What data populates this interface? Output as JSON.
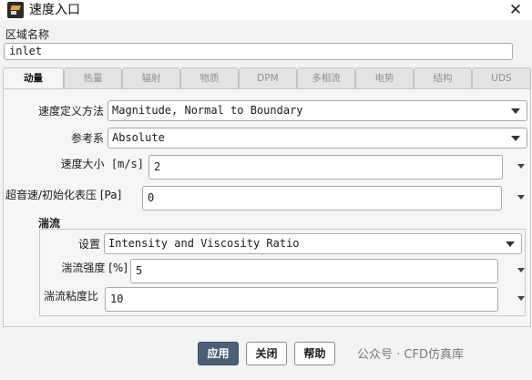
{
  "window": {
    "title": "速度入口",
    "close_glyph": "✕"
  },
  "zone": {
    "label": "区域名称",
    "value": "inlet"
  },
  "tabs": [
    {
      "label": "动量",
      "active": true
    },
    {
      "label": "热量",
      "active": false
    },
    {
      "label": "辐射",
      "active": false
    },
    {
      "label": "物质",
      "active": false
    },
    {
      "label": "DPM",
      "active": false
    },
    {
      "label": "多相流",
      "active": false
    },
    {
      "label": "电势",
      "active": false
    },
    {
      "label": "结构",
      "active": false
    },
    {
      "label": "UDS",
      "active": false
    }
  ],
  "momentum": {
    "velocity_spec": {
      "label": "速度定义方法",
      "value": "Magnitude, Normal to Boundary"
    },
    "reference_frame": {
      "label": "参考系",
      "value": "Absolute"
    },
    "velocity_magnitude": {
      "label": "速度大小 [m/s]",
      "value": "2"
    },
    "gauge_pressure": {
      "label": "超音速/初始化表压 [Pa]",
      "value": "0"
    }
  },
  "turbulence": {
    "title": "湍流",
    "spec": {
      "label": "设置",
      "value": "Intensity and Viscosity Ratio"
    },
    "intensity": {
      "label": "湍流强度 [%]",
      "value": "5"
    },
    "viscosity_ratio": {
      "label": "湍流粘度比",
      "value": "10"
    }
  },
  "buttons": {
    "apply": "应用",
    "close": "关闭",
    "help": "帮助"
  },
  "watermark": "公众号 · CFD仿真库",
  "colors": {
    "primary_button": "#4a6079",
    "background": "#f3f3f3"
  }
}
